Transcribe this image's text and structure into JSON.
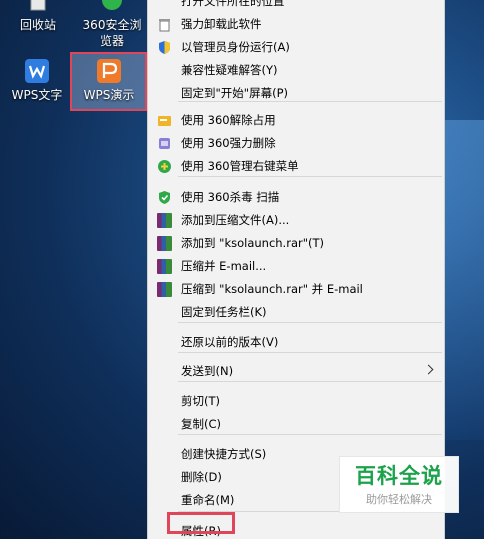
{
  "desktop": {
    "icons": [
      {
        "label": "回收站"
      },
      {
        "label": "360安全浏览器"
      },
      {
        "label": "WPS文字"
      },
      {
        "label": "WPS演示"
      }
    ]
  },
  "context_menu": {
    "top_partial": "打开文件所在的位置",
    "items": [
      "强力卸载此软件",
      "以管理员身份运行(A)",
      "兼容性疑难解答(Y)",
      "固定到\"开始\"屏幕(P)",
      "使用 360解除占用",
      "使用 360强力删除",
      "使用 360管理右键菜单",
      "使用 360杀毒 扫描",
      "添加到压缩文件(A)...",
      "添加到 \"ksolaunch.rar\"(T)",
      "压缩并 E-mail...",
      "压缩到 \"ksolaunch.rar\" 并 E-mail",
      "固定到任务栏(K)",
      "还原以前的版本(V)",
      "发送到(N)",
      "剪切(T)",
      "复制(C)",
      "创建快捷方式(S)",
      "删除(D)",
      "重命名(M)",
      "属性(R)"
    ]
  },
  "watermark": {
    "title": "百科全说",
    "subtitle": "助你轻松解决"
  },
  "colors": {
    "highlight": "#e0465a",
    "watermark_green": "#1aa34a"
  }
}
